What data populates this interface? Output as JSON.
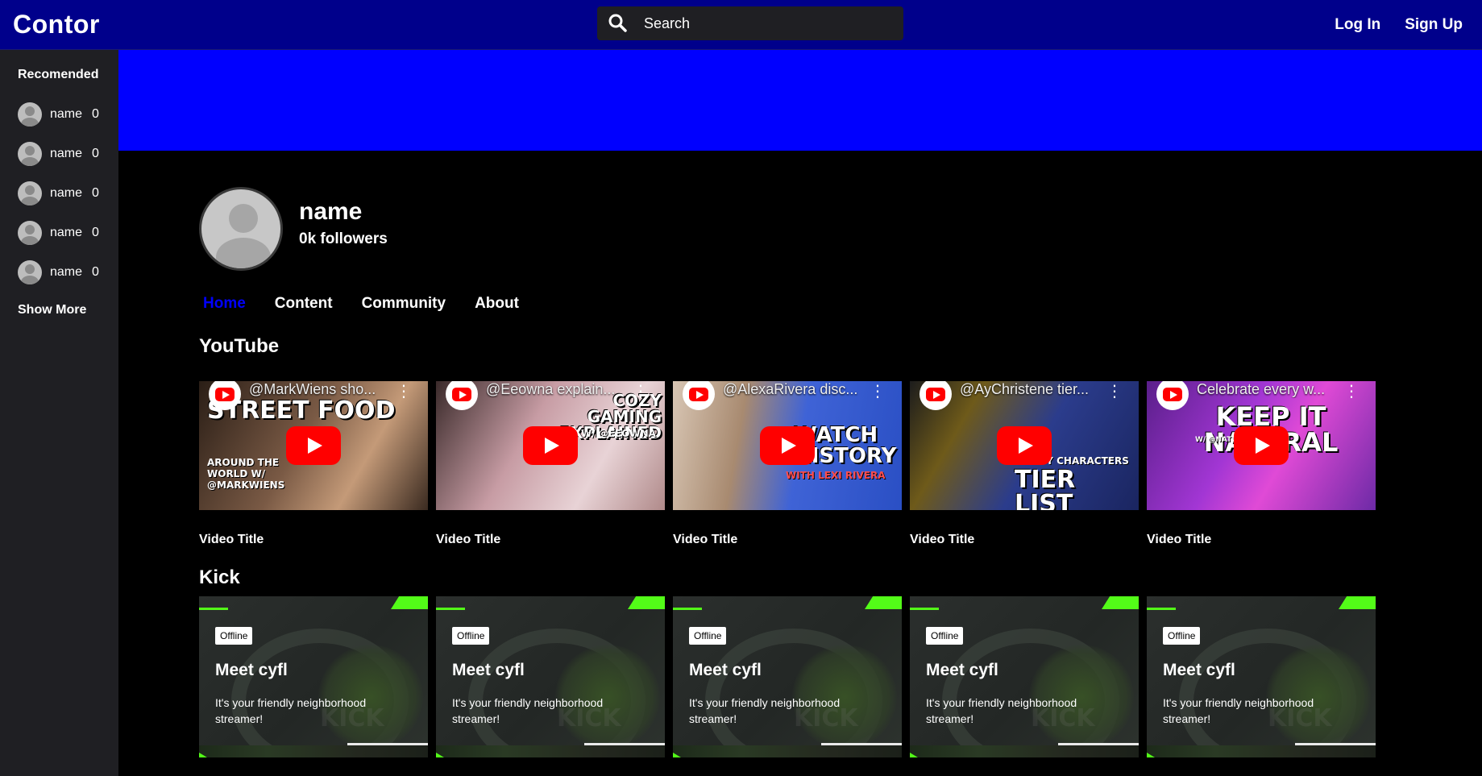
{
  "app": {
    "logo": "Contor"
  },
  "search": {
    "placeholder": "Search"
  },
  "auth": {
    "login": "Log In",
    "signup": "Sign Up"
  },
  "sidebar": {
    "title": "Recomended",
    "items": [
      {
        "name": "name",
        "count": "0"
      },
      {
        "name": "name",
        "count": "0"
      },
      {
        "name": "name",
        "count": "0"
      },
      {
        "name": "name",
        "count": "0"
      },
      {
        "name": "name",
        "count": "0"
      }
    ],
    "show_more": "Show More"
  },
  "profile": {
    "name": "name",
    "followers": "0k followers"
  },
  "tabs": [
    "Home",
    "Content",
    "Community",
    "About"
  ],
  "sections": {
    "youtube": "YouTube",
    "kick": "Kick"
  },
  "youtube": {
    "videos": [
      {
        "overlay": "@MarkWiens sho...",
        "title": "Video Title",
        "thumb_big": "STREET FOOD",
        "thumb_small": "AROUND THE WORLD W/ @MARKWIENS",
        "bg": "#6b4a38"
      },
      {
        "overlay": "@Eeowna explain...",
        "title": "Video Title",
        "thumb_big": "COZY GAMING EXPLAINED",
        "thumb_small": "W/ @EEOWNA",
        "bg": "#b88c94"
      },
      {
        "overlay": "@AlexaRivera disc...",
        "title": "Video Title",
        "thumb_big": "WATCH HISTORY",
        "thumb_small": "WITH LEXI RIVERA",
        "bg": "#3a5fcf"
      },
      {
        "overlay": "@AyChristene tier...",
        "title": "Video Title",
        "thumb_big": "TIER LIST",
        "thumb_small": "CREEPY CHARACTERS",
        "bg": "#2a3a8f"
      },
      {
        "overlay": "Celebrate every w...",
        "title": "Video Title",
        "thumb_big": "KEEP IT NATURAL",
        "thumb_small": "W/ @NATURALREIGN",
        "bg": "#8a2bb8"
      }
    ]
  },
  "kick": {
    "cards": [
      {
        "status": "Offline",
        "title": "Meet cyfl",
        "desc": "It's your friendly neighborhood streamer!"
      },
      {
        "status": "Offline",
        "title": "Meet cyfl",
        "desc": "It's your friendly neighborhood streamer!"
      },
      {
        "status": "Offline",
        "title": "Meet cyfl",
        "desc": "It's your friendly neighborhood streamer!"
      },
      {
        "status": "Offline",
        "title": "Meet cyfl",
        "desc": "It's your friendly neighborhood streamer!"
      },
      {
        "status": "Offline",
        "title": "Meet cyfl",
        "desc": "It's your friendly neighborhood streamer!"
      }
    ],
    "watermark": "KICK"
  },
  "colors": {
    "topbar": "#00008b",
    "banner": "#0000ff",
    "active_tab": "#0000ff",
    "kick_green": "#53fc18",
    "yt_red": "#ff0000"
  }
}
